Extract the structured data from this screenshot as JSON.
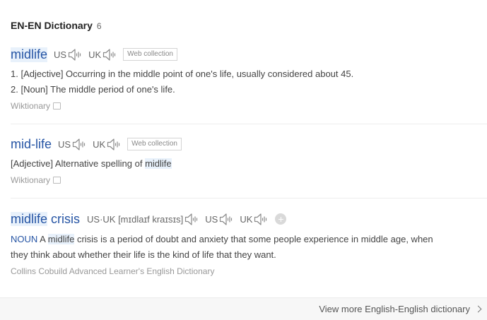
{
  "header": {
    "title": "EN-EN Dictionary",
    "count": "6"
  },
  "entries": [
    {
      "word": "midlife",
      "us": "US",
      "uk": "UK",
      "web_collection": "Web collection",
      "definitions": [
        "1. [Adjective] Occurring in the middle point of one's life, usually considered about 45.",
        "2. [Noun] The middle period of one's life."
      ],
      "source": "Wiktionary"
    },
    {
      "word": "mid-life",
      "us": "US",
      "uk": "UK",
      "web_collection": "Web collection",
      "definition_prefix": "[Adjective] Alternative spelling of ",
      "definition_link": "midlife",
      "source": "Wiktionary"
    },
    {
      "word_highlight": "midlife",
      "word_rest": " crisis",
      "phonetic": "US·UK [mɪdlaɪf kraɪsɪs]",
      "us": "US",
      "uk": "UK",
      "pos": "NOUN",
      "def_pre": " A ",
      "def_highlight": "midlife",
      "def_post": " crisis is a period of doubt and anxiety that some people experience in middle age, when",
      "def_line2": "they think about whether their life is the kind of life that they want.",
      "source": "Collins Cobuild Advanced Learner's English Dictionary",
      "add_label": "+"
    }
  ],
  "footer": {
    "view_more": "View more English-English dictionary"
  },
  "colors": {
    "link_blue": "#2554a4",
    "highlight": "#e8f1fb",
    "muted": "#999999"
  },
  "icons": [
    "speaker-icon",
    "copy-icon",
    "plus-icon",
    "chevron-right-icon"
  ]
}
